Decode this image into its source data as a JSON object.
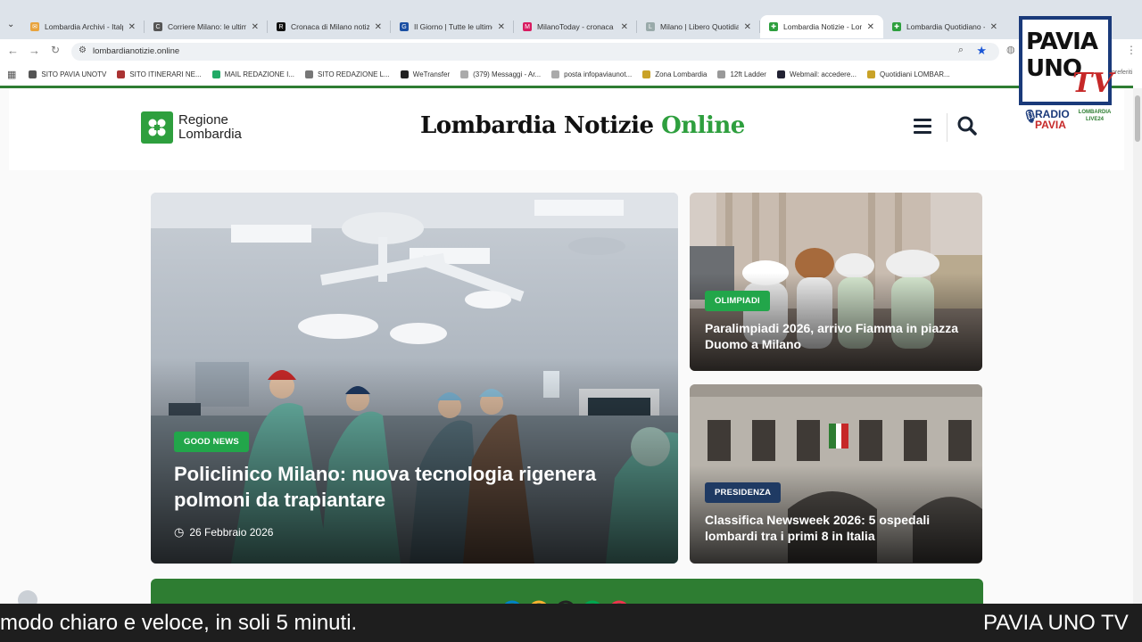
{
  "browser": {
    "tabs": [
      {
        "title": "Lombardia Archivi - Italp",
        "color": "#e8a33d",
        "glyph": "✉"
      },
      {
        "title": "Corriere Milano: le ultime",
        "color": "#555",
        "glyph": "C"
      },
      {
        "title": "Cronaca di Milano notizie",
        "color": "#111",
        "glyph": "R"
      },
      {
        "title": "Il Giorno | Tutte le ultime",
        "color": "#1a4fa3",
        "glyph": "G"
      },
      {
        "title": "MilanoToday - cronaca e",
        "color": "#d81b60",
        "glyph": "M"
      },
      {
        "title": "Milano | Libero Quotidian",
        "color": "#9aa",
        "glyph": "L"
      },
      {
        "title": "Lombardia Notizie - Lom",
        "color": "#2e9f3e",
        "glyph": "✚"
      },
      {
        "title": "Lombardia Quotidiano -",
        "color": "#2e9f3e",
        "glyph": "✚"
      }
    ],
    "url": "lombardianotizie.online",
    "bookmarks": [
      {
        "label": "SITO PAVIA UNOTV",
        "color": "#555"
      },
      {
        "label": "SITO ITINERARI NE...",
        "color": "#a33"
      },
      {
        "label": "MAIL REDAZIONE I...",
        "color": "#2a6"
      },
      {
        "label": "SITO REDAZIONE L...",
        "color": "#777"
      },
      {
        "label": "WeTransfer",
        "color": "#222"
      },
      {
        "label": "(379) Messaggi - Ar...",
        "color": "#aaa"
      },
      {
        "label": "posta infopaviaunot...",
        "color": "#aaa"
      },
      {
        "label": "Zona Lombardia",
        "color": "#c9a227"
      },
      {
        "label": "12ft Ladder",
        "color": "#999"
      },
      {
        "label": "Webmail: accedere...",
        "color": "#223"
      },
      {
        "label": "Quotidiani LOMBAR...",
        "color": "#c9a227"
      }
    ],
    "bookmarks_overflow": "preferiti"
  },
  "site": {
    "brand_logo_text": "Regione\nLombardia",
    "title_main": "Lombardia Notizie",
    "title_accent": "Online"
  },
  "articles": {
    "main": {
      "category": "GOOD NEWS",
      "category_color": "#22a64a",
      "title": "Policlinico Milano: nuova tecnologia rigenera polmoni da trapiantare",
      "date": "26 Febbraio 2026"
    },
    "side1": {
      "category": "OLIMPIADI",
      "category_color": "#22a64a",
      "title": "Paralimpiadi 2026, arrivo Fiamma in piazza Duomo a Milano"
    },
    "side2": {
      "category": "PRESIDENZA",
      "category_color": "#1f3a63",
      "title": "Classifica Newsweek 2026: 5 ospedali lombardi tra i primi 8 in Italia"
    }
  },
  "overlay": {
    "ticker_text": "modo chiaro e veloce, in soli 5 minuti.",
    "ticker_brand": "PAVIA UNO TV",
    "logo_line1": "PAVIA",
    "logo_line2": "UNO",
    "logo_tv": "TV",
    "radio_label": "RADIO",
    "radio_name": "PAVIA",
    "live_label": "LOMBARDIA LIVE24"
  }
}
